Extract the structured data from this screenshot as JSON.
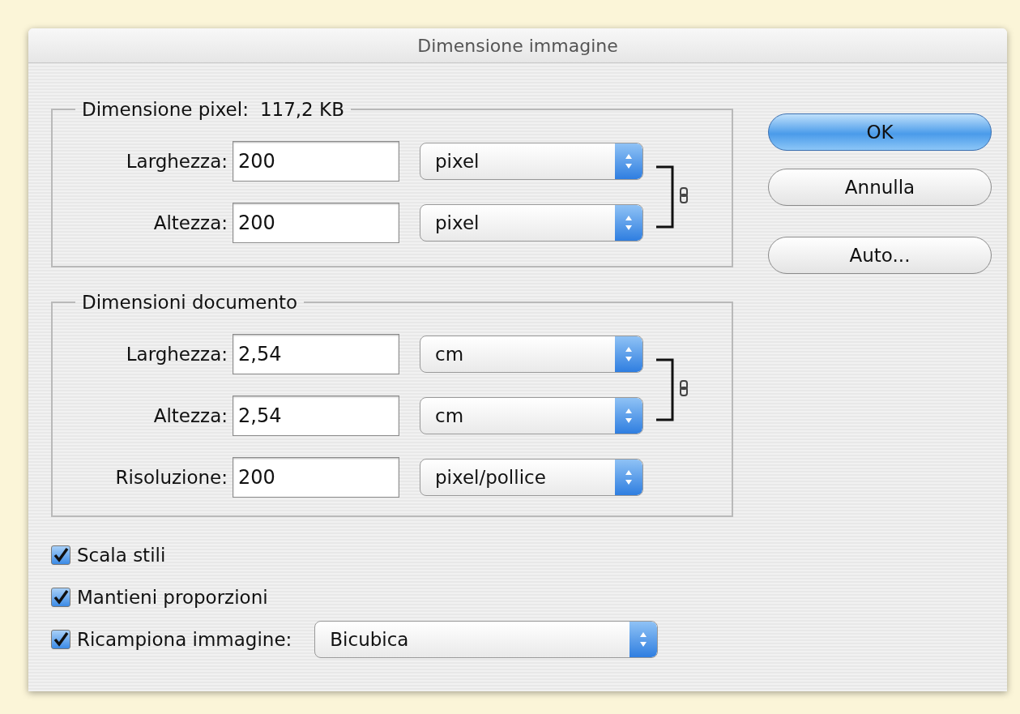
{
  "window": {
    "title": "Dimensione immagine"
  },
  "pixel_dimensions": {
    "title": "Dimensione pixel:",
    "size": "117,2 KB",
    "linked": true,
    "rows": [
      {
        "label": "Larghezza:",
        "value": "200",
        "unit": "pixel"
      },
      {
        "label": "Altezza:",
        "value": "200",
        "unit": "pixel"
      }
    ]
  },
  "document_size": {
    "title": "Dimensioni documento",
    "linked": true,
    "rows": [
      {
        "label": "Larghezza:",
        "value": "2,54",
        "unit": "cm"
      },
      {
        "label": "Altezza:",
        "value": "2,54",
        "unit": "cm"
      },
      {
        "label": "Risoluzione:",
        "value": "200",
        "unit": "pixel/pollice"
      }
    ]
  },
  "options": [
    {
      "label": "Scala stili",
      "checked": true
    },
    {
      "label": "Mantieni proporzioni",
      "checked": true
    },
    {
      "label": "Ricampiona immagine:",
      "checked": true,
      "select": "Bicubica"
    }
  ],
  "buttons": [
    {
      "label": "OK",
      "default": true
    },
    {
      "label": "Annulla",
      "default": false
    },
    {
      "label": "Auto...",
      "default": false
    }
  ]
}
